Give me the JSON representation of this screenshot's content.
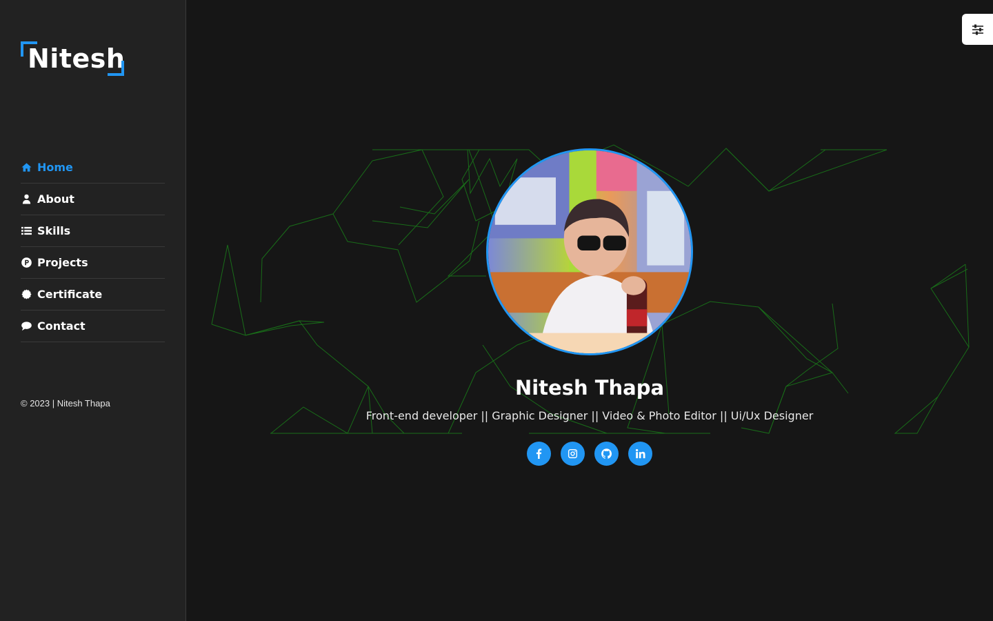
{
  "brand": {
    "logo_text": "Nitesh",
    "accent_color": "#2196f3"
  },
  "nav": {
    "items": [
      {
        "label": "Home",
        "icon": "home-icon",
        "active": true
      },
      {
        "label": "About",
        "icon": "user-icon",
        "active": false
      },
      {
        "label": "Skills",
        "icon": "list-icon",
        "active": false
      },
      {
        "label": "Projects",
        "icon": "product-hunt-icon",
        "active": false
      },
      {
        "label": "Certificate",
        "icon": "certificate-icon",
        "active": false
      },
      {
        "label": "Contact",
        "icon": "chat-bubble-icon",
        "active": false
      }
    ]
  },
  "footer": {
    "copyright": "© 2023 | Nitesh Thapa"
  },
  "hero": {
    "name": "Nitesh Thapa",
    "roles": "Front-end developer || Graphic Designer || Video & Photo Editor || Ui/Ux Designer",
    "photo_icon": "profile-photo"
  },
  "socials": [
    {
      "name": "facebook",
      "icon": "facebook-icon"
    },
    {
      "name": "instagram",
      "icon": "instagram-icon"
    },
    {
      "name": "github",
      "icon": "github-icon"
    },
    {
      "name": "linkedin",
      "icon": "linkedin-icon"
    }
  ],
  "settings": {
    "icon": "sliders-icon"
  },
  "colors": {
    "background": "#161616",
    "sidebar": "#222222",
    "network_lines": "#1a8a1a"
  }
}
